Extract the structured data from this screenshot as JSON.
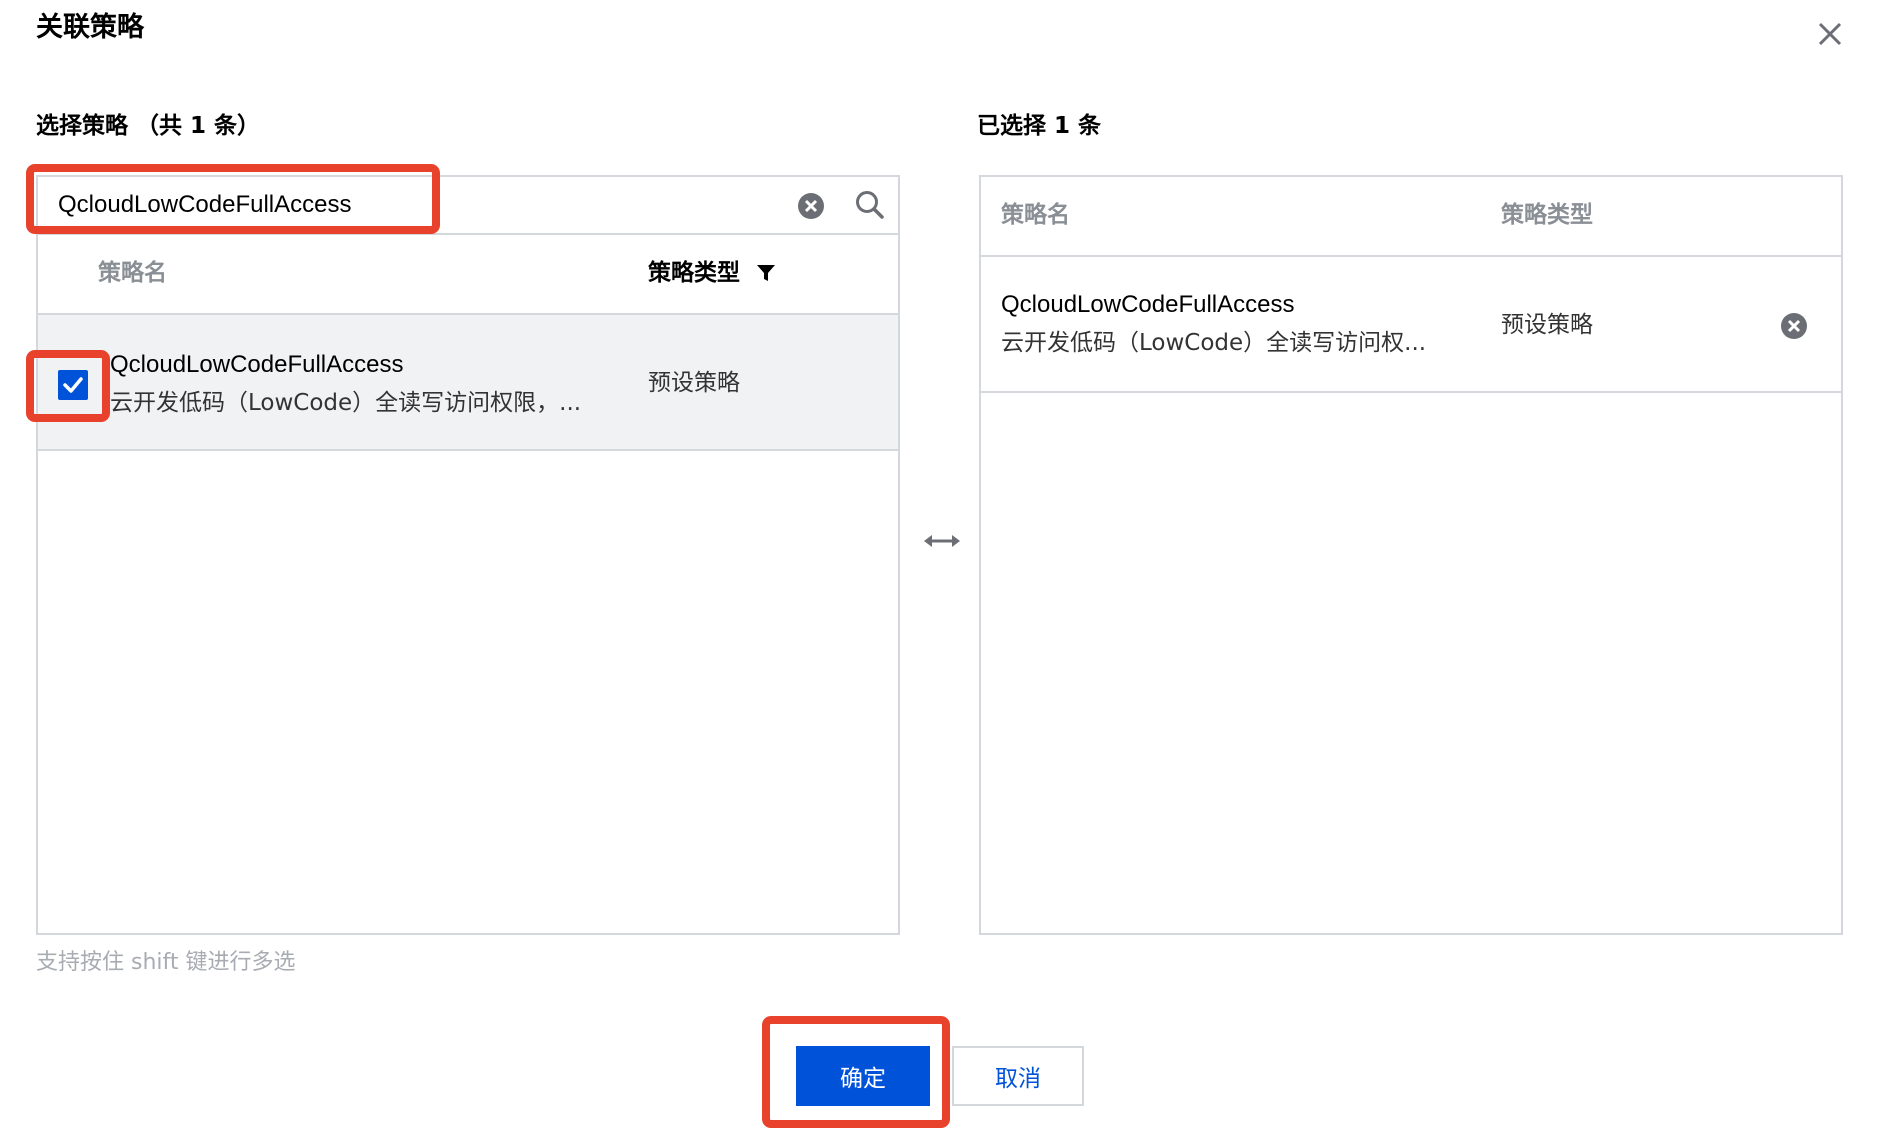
{
  "dialog": {
    "title": "关联策略"
  },
  "left": {
    "title": "选择策略 （共 1 条）",
    "search": {
      "value": "QcloudLowCodeFullAccess",
      "placeholder": ""
    },
    "columns": {
      "name": "策略名",
      "type": "策略类型"
    },
    "rows": [
      {
        "name": "QcloudLowCodeFullAccess",
        "desc": "云开发低码（LowCode）全读写访问权限，...",
        "type": "预设策略",
        "checked": true
      }
    ],
    "hint": "支持按住 shift 键进行多选"
  },
  "right": {
    "title": "已选择 1 条",
    "columns": {
      "name": "策略名",
      "type": "策略类型"
    },
    "rows": [
      {
        "name": "QcloudLowCodeFullAccess",
        "desc": "云开发低码（LowCode）全读写访问权...",
        "type": "预设策略"
      }
    ]
  },
  "buttons": {
    "confirm": "确定",
    "cancel": "取消"
  },
  "colors": {
    "primary": "#0052d9",
    "highlight": "#e8412c",
    "border": "#d4d8dd",
    "selected_row": "#f1f2f4"
  },
  "icons": {
    "close": "close-icon",
    "clear": "clear-circle-icon",
    "search": "search-icon",
    "filter": "filter-icon",
    "swap": "swap-horizontal-icon",
    "remove": "remove-circle-icon",
    "check": "check-icon"
  }
}
